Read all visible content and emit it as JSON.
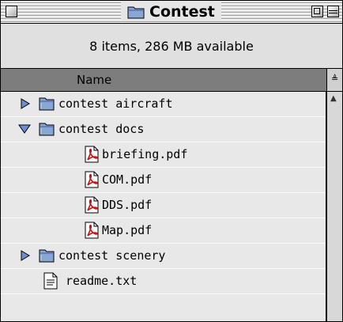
{
  "window": {
    "title": "Contest"
  },
  "info": {
    "text": "8 items, 286 MB available"
  },
  "columns": {
    "name": "Name"
  },
  "sort": {
    "glyph": "≜"
  },
  "scroll": {
    "up_glyph": "▲"
  },
  "rows": [
    {
      "label": "contest aircraft",
      "kind": "folder",
      "expand": "collapsed"
    },
    {
      "label": "contest docs",
      "kind": "folder",
      "expand": "expanded"
    },
    {
      "label": "briefing.pdf",
      "kind": "pdf",
      "expand": "none"
    },
    {
      "label": "COM.pdf",
      "kind": "pdf",
      "expand": "none"
    },
    {
      "label": "DDS.pdf",
      "kind": "pdf",
      "expand": "none"
    },
    {
      "label": "Map.pdf",
      "kind": "pdf",
      "expand": "none"
    },
    {
      "label": "contest scenery",
      "kind": "folder",
      "expand": "collapsed"
    },
    {
      "label": "readme.txt",
      "kind": "text",
      "expand": "none"
    }
  ],
  "colors": {
    "folder": "#8aa6d6",
    "pdf_red": "#cc1111",
    "header_bg": "#7d7d7d",
    "list_bg": "#e8e8e8"
  }
}
